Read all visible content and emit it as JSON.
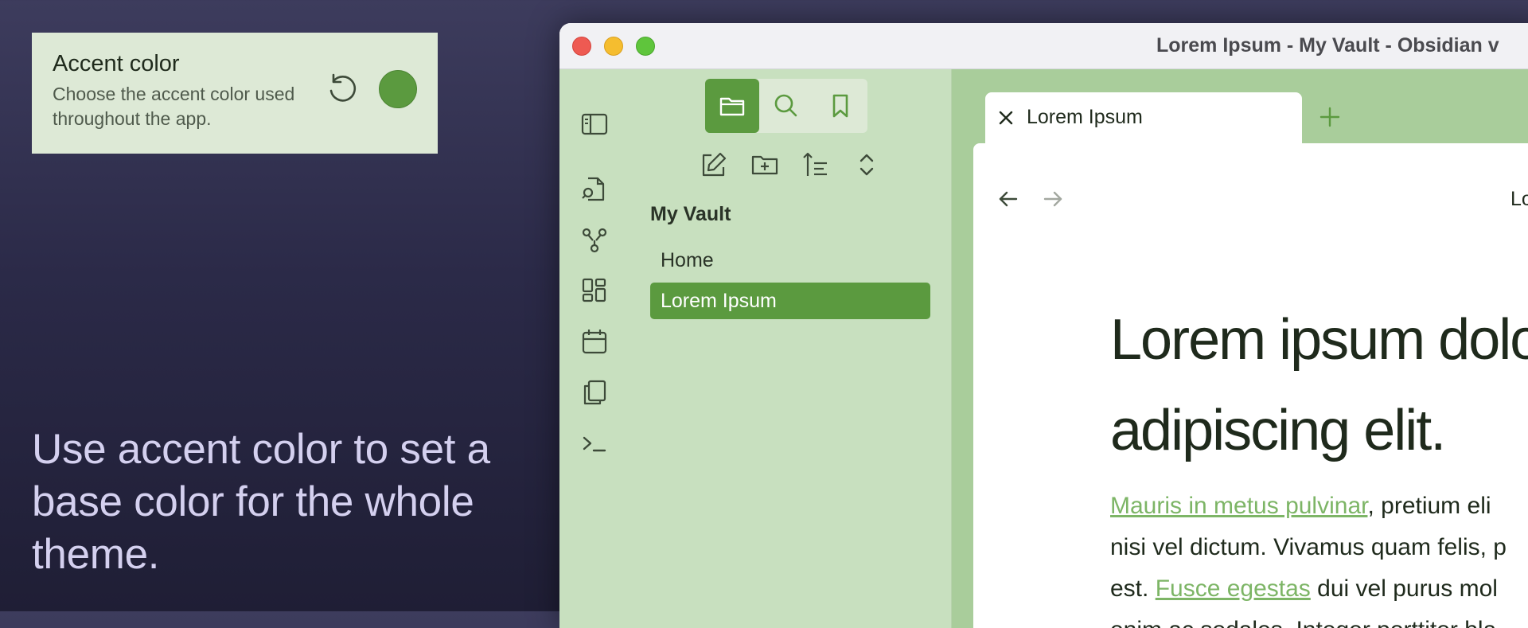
{
  "setting": {
    "title": "Accent color",
    "description": "Choose the accent color used throughout the app.",
    "accent_color": "#5b9a3f",
    "reset_icon": "reset-icon"
  },
  "caption": "Use accent color to set a base color for the whole theme.",
  "window": {
    "title": "Lorem Ipsum - My Vault - Obsidian v"
  },
  "ribbon": {
    "icons": [
      "sidebar-toggle-icon",
      "search-file-icon",
      "graph-icon",
      "canvas-icon",
      "calendar-icon",
      "copy-icon",
      "terminal-icon"
    ]
  },
  "sidebar": {
    "view_tabs": [
      "files",
      "search",
      "bookmarks"
    ],
    "file_actions": [
      "new-note",
      "new-folder",
      "sort",
      "collapse"
    ],
    "vault_name": "My Vault",
    "items": [
      {
        "label": "Home",
        "selected": false
      },
      {
        "label": "Lorem Ipsum",
        "selected": true
      }
    ]
  },
  "tabs": {
    "active_label": "Lorem Ipsum"
  },
  "view_header": {
    "title": "Lo"
  },
  "document": {
    "heading": "Lorem ipsum dolor adipiscing elit.",
    "link1": "Mauris in metus pulvinar",
    "text1": ", pretium eli",
    "text2": "nisi vel dictum. Vivamus quam felis, p",
    "text3": "est. ",
    "link2": "Fusce egestas",
    "text4": " dui vel purus mol",
    "text5": "enim ac sodales. Integer porttitor bla"
  },
  "colors": {
    "accent": "#5b9a3f",
    "sidebar_bg": "#c8e0bf",
    "tabbar_bg": "#a9cd9b",
    "link": "#7db566"
  }
}
